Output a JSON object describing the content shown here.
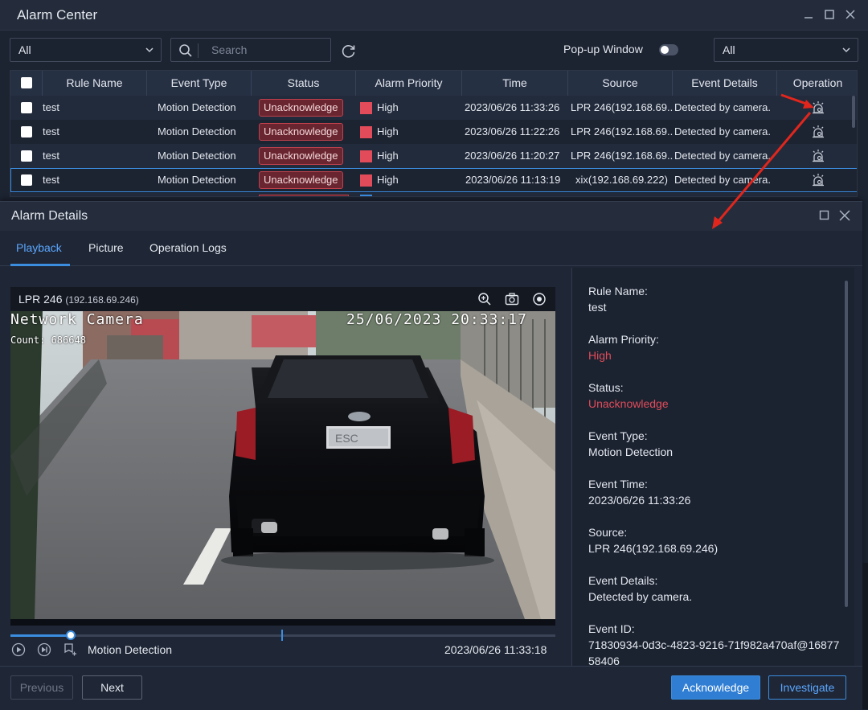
{
  "window": {
    "title": "Alarm Center"
  },
  "toolbar": {
    "filter_left": "All",
    "search_placeholder": "Search",
    "popup_label": "Pop-up Window",
    "popup_enabled": false,
    "filter_right": "All"
  },
  "table": {
    "columns": [
      "Rule Name",
      "Event Type",
      "Status",
      "Alarm Priority",
      "Time",
      "Source",
      "Event Details",
      "Operation"
    ],
    "rows": [
      {
        "rule": "test",
        "event_type": "Motion Detection",
        "status": "Unacknowledge",
        "priority": "High",
        "time": "2023/06/26 11:33:26",
        "source": "LPR 246(192.168.69...",
        "details": "Detected by camera."
      },
      {
        "rule": "test",
        "event_type": "Motion Detection",
        "status": "Unacknowledge",
        "priority": "High",
        "time": "2023/06/26 11:22:26",
        "source": "LPR 246(192.168.69...",
        "details": "Detected by camera."
      },
      {
        "rule": "test",
        "event_type": "Motion Detection",
        "status": "Unacknowledge",
        "priority": "High",
        "time": "2023/06/26 11:20:27",
        "source": "LPR 246(192.168.69...",
        "details": "Detected by camera."
      },
      {
        "rule": "test",
        "event_type": "Motion Detection",
        "status": "Unacknowledge",
        "priority": "High",
        "time": "2023/06/26 11:13:19",
        "source": "xix(192.168.69.222)",
        "details": "Detected by camera."
      }
    ]
  },
  "details": {
    "title": "Alarm Details",
    "tabs": [
      "Playback",
      "Picture",
      "Operation Logs"
    ],
    "player": {
      "camera_name": "LPR 246",
      "camera_ip": "(192.168.69.246)",
      "osd_title": "Network Camera",
      "osd_datetime": "25/06/2023 20:33:17",
      "osd_count": "Count: 686648",
      "event_label": "Motion Detection",
      "timestamp": "2023/06/26 11:33:18",
      "plate_text": "ESC ",
      "progress": 0.11
    },
    "info": {
      "rule_label": "Rule Name:",
      "rule_value": "test",
      "priority_label": "Alarm Priority:",
      "priority_value": "High",
      "status_label": "Status:",
      "status_value": "Unacknowledge",
      "type_label": "Event Type:",
      "type_value": "Motion Detection",
      "time_label": "Event Time:",
      "time_value": "2023/06/26 11:33:26",
      "source_label": "Source:",
      "source_value": "LPR 246(192.168.69.246)",
      "details_label": "Event Details:",
      "details_value": "Detected by camera.",
      "id_label": "Event ID:",
      "id_value": "71830934-0d3c-4823-9216-71f982a470af@1687758406"
    },
    "buttons": {
      "previous": "Previous",
      "next": "Next",
      "acknowledge": "Acknowledge",
      "investigate": "Investigate"
    }
  },
  "colors": {
    "accent": "#3b8de0",
    "alarm_red": "#e24c5a",
    "annotation_arrow": "#e0261d"
  }
}
